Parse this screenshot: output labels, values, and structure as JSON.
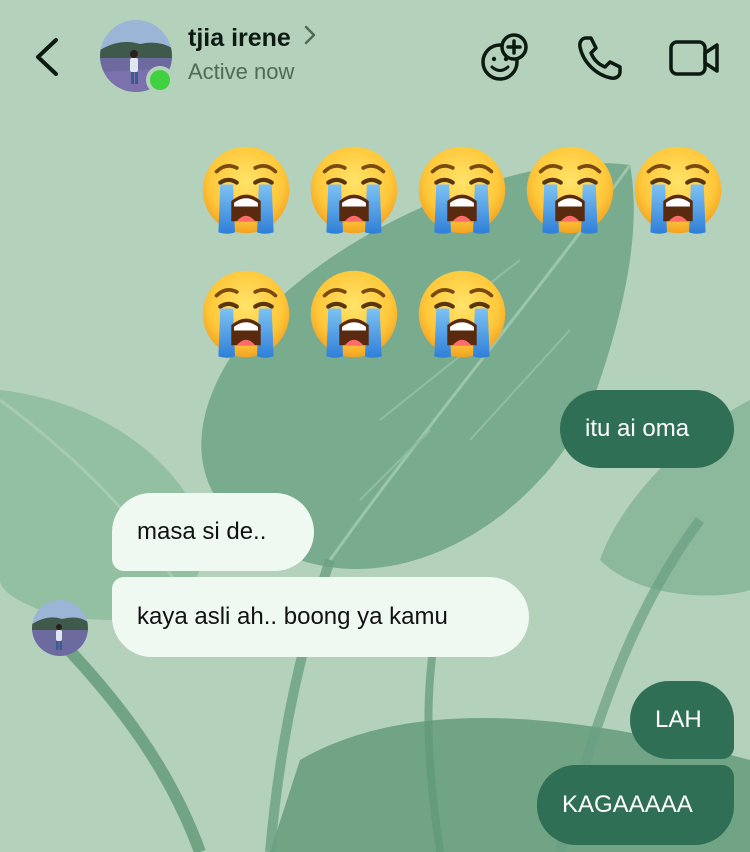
{
  "header": {
    "contact_name": "tjia irene",
    "status": "Active now",
    "icons": {
      "back": "chevron-left-icon",
      "chevron": "chevron-right-icon",
      "effects": "emoji-plus-icon",
      "call": "phone-icon",
      "video": "video-camera-icon"
    }
  },
  "messages": {
    "emoji_block": {
      "emoji": "loudly-crying-face",
      "count": 8
    },
    "out_1": "itu ai oma",
    "in_1": "masa si de..",
    "in_2": "kaya asli ah.. boong ya kamu",
    "out_2": "LAH",
    "out_3": "KAGAAAAA"
  },
  "colors": {
    "background": "#b4d1bb",
    "outgoing_bubble": "#2f6f55",
    "incoming_bubble": "#eff9f2",
    "online": "#3fd13f"
  }
}
